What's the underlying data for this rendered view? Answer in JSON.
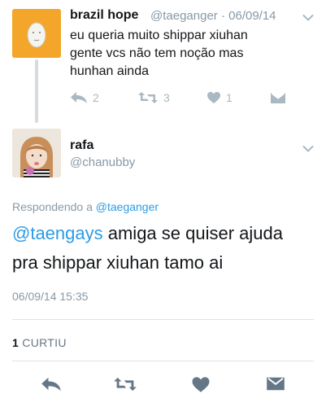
{
  "original_tweet": {
    "name": "brazil hope",
    "handle": "@taeganger",
    "date": "06/09/14",
    "lines": [
      "eu queria muito shippar xiuhan",
      "gente vcs não tem noção mas",
      "hunhan ainda"
    ],
    "reply_count": "2",
    "retweet_count": "3",
    "like_count": "1"
  },
  "reply_tweet": {
    "name": "rafa",
    "handle": "@chanubby",
    "replying_prefix": "Respondendo a",
    "replying_to": "@taeganger",
    "mention": "@taengays",
    "text_after_mention": "amiga se quiser ajuda",
    "text_line2": "pra shippar xiuhan tamo ai",
    "timestamp": "06/09/14 15:35",
    "likes_count": "1",
    "likes_label": "CURTIU"
  },
  "colors": {
    "link": "#2b9be5",
    "muted": "#8899a6",
    "icon": "#aab8c2",
    "icon_dark": "#657786",
    "avatar_orange": "#f3a629"
  },
  "icons": [
    "chevron-down-icon",
    "reply-icon",
    "retweet-icon",
    "heart-icon",
    "dm-icon"
  ]
}
